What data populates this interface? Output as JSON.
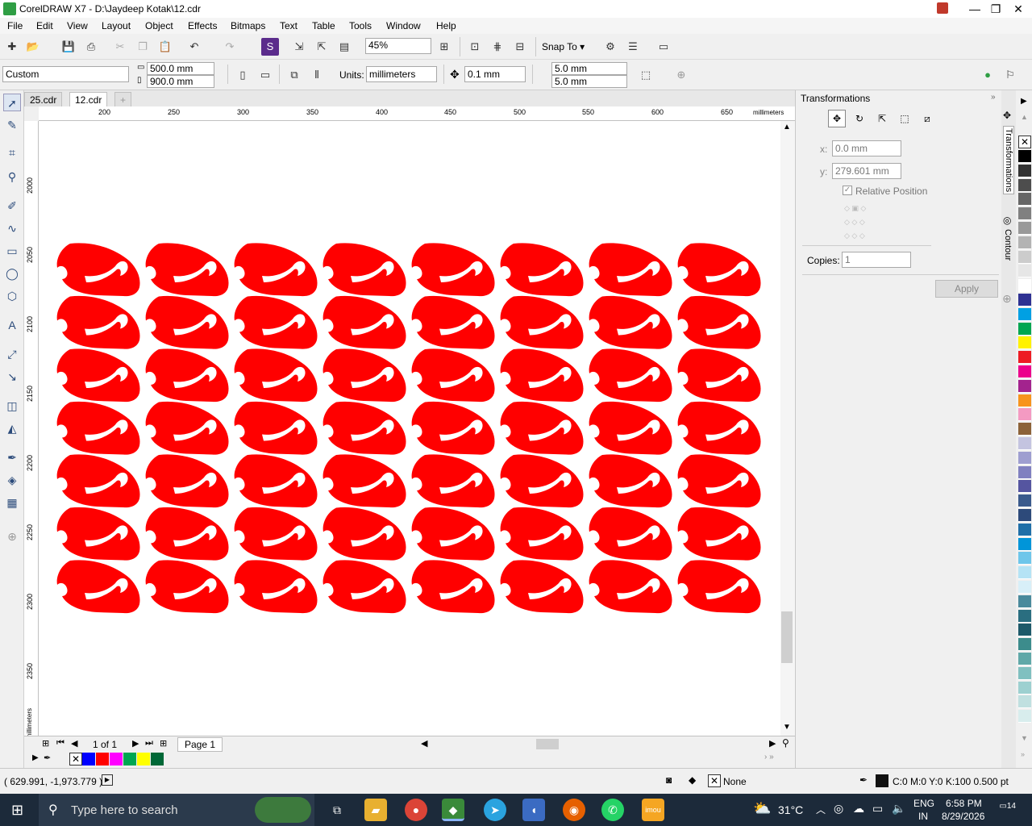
{
  "app": {
    "title": "CorelDRAW X7 - D:\\Jaydeep Kotak\\12.cdr",
    "window_controls": {
      "minimize": "—",
      "restore": "❐",
      "close": "✕"
    }
  },
  "menu": [
    "File",
    "Edit",
    "View",
    "Layout",
    "Object",
    "Effects",
    "Bitmaps",
    "Text",
    "Table",
    "Tools",
    "Window",
    "Help"
  ],
  "toolbar": {
    "zoom": "45%",
    "snap_to": "Snap To"
  },
  "property_bar": {
    "preset": "Custom",
    "width": "500.0 mm",
    "height": "900.0 mm",
    "units_label": "Units:",
    "units": "millimeters",
    "nudge": "0.1 mm",
    "dup_x": "5.0 mm",
    "dup_y": "5.0 mm"
  },
  "doc_tabs": [
    "25.cdr",
    "12.cdr"
  ],
  "rulers": {
    "h_ticks": [
      "200",
      "250",
      "300",
      "350",
      "400",
      "450",
      "500",
      "550",
      "600",
      "650"
    ],
    "h_unit": "millimeters",
    "v_ticks": [
      "2000",
      "2050",
      "2100",
      "2150",
      "2200",
      "2250",
      "2300",
      "2350"
    ],
    "v_unit": "millimeters"
  },
  "artwork": {
    "fill_color": "#ff0000",
    "rows": 7,
    "cols": 8
  },
  "page_nav": {
    "page_count": "1 of 1",
    "page_tab": "Page 1"
  },
  "transformations": {
    "title": "Transformations",
    "x_label": "x:",
    "x_value": "0.0 mm",
    "y_label": "y:",
    "y_value": "279.601 mm",
    "relative_position": "Relative Position",
    "copies_label": "Copies:",
    "copies_value": "1",
    "apply": "Apply"
  },
  "dock_tabs": [
    "Transformations",
    "Contour"
  ],
  "palette_colors": [
    "#000000",
    "#333333",
    "#4d4d4d",
    "#666666",
    "#808080",
    "#999999",
    "#b3b3b3",
    "#cccccc",
    "#e6e6e6",
    "#ffffff",
    "#2e3192",
    "#00a0e3",
    "#00a651",
    "#fff200",
    "#ed1c24",
    "#ec008c",
    "#a3238e",
    "#f7941d",
    "#f49ac2",
    "#8c6239",
    "#c4c4e0",
    "#9e9ed0",
    "#8080c0",
    "#5555a0",
    "#3a5a8c",
    "#2d4a7a",
    "#1f6fa8",
    "#0095d9",
    "#6ec6ea",
    "#b5e3f5",
    "#d8eff8",
    "#4a8a9c",
    "#2a6e80",
    "#1e5a6a",
    "#3c8c8c",
    "#60a8a8",
    "#80c0c0",
    "#9dd0d0",
    "#c0e0e0",
    "#d8eded"
  ],
  "doc_palette": [
    "#0000ff",
    "#ff0000",
    "#ff00ff",
    "#00a651",
    "#ffff00",
    "#006837"
  ],
  "status": {
    "coords": "( 629.991, -1,973.779 )",
    "fill": "None",
    "outline": "C:0 M:0 Y:0 K:100  0.500 pt"
  },
  "taskbar": {
    "search": "Type here to search",
    "weather": "31°C",
    "lang": "ENG",
    "region": "IN",
    "time": "6:58 PM",
    "date": "8/29/2026",
    "notifications": "14"
  }
}
